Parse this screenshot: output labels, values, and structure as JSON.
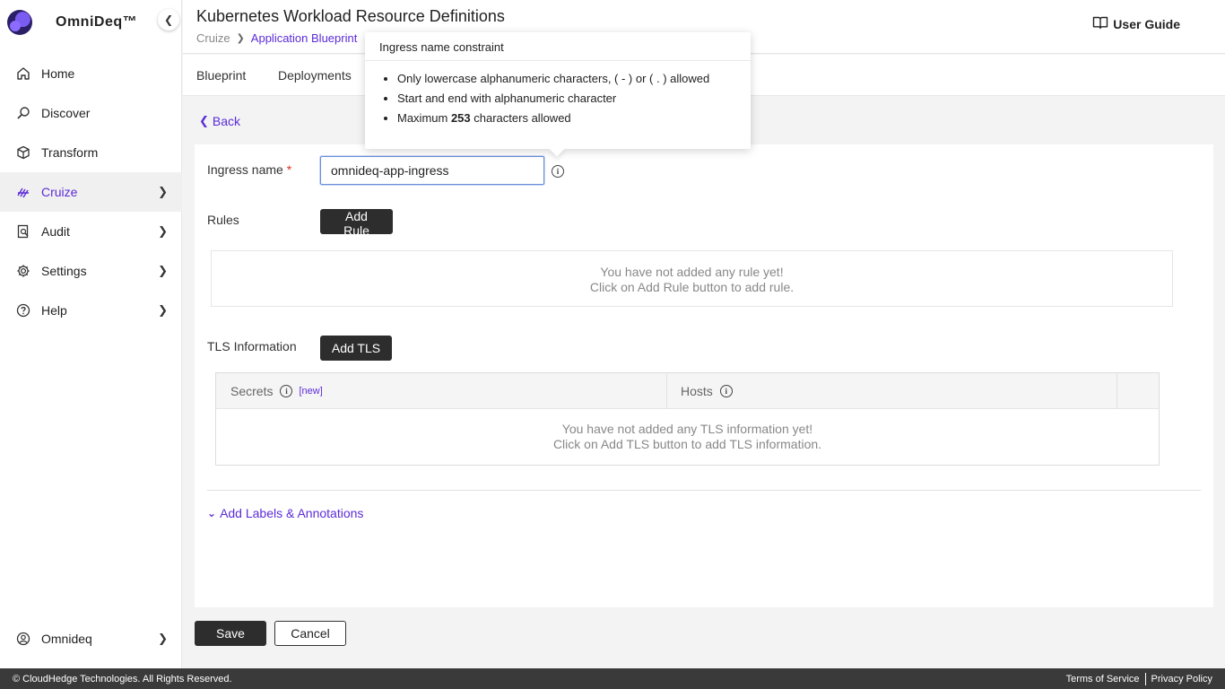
{
  "brand": {
    "name": "OmniDeq™"
  },
  "sidebar": {
    "items": [
      {
        "label": "Home",
        "icon": "home-icon",
        "chevron": false
      },
      {
        "label": "Discover",
        "icon": "discover-icon",
        "chevron": false
      },
      {
        "label": "Transform",
        "icon": "cube-icon",
        "chevron": false
      },
      {
        "label": "Cruize",
        "icon": "cruize-icon",
        "chevron": true,
        "active": true
      },
      {
        "label": "Audit",
        "icon": "audit-icon",
        "chevron": true
      },
      {
        "label": "Settings",
        "icon": "gear-icon",
        "chevron": true
      },
      {
        "label": "Help",
        "icon": "help-icon",
        "chevron": true
      }
    ],
    "footer": {
      "label": "Omnideq",
      "icon": "user-icon"
    }
  },
  "header": {
    "title": "Kubernetes Workload Resource Definitions",
    "breadcrumb": [
      "Cruize",
      "Application Blueprint"
    ],
    "user_guide": "User Guide"
  },
  "tabs": [
    "Blueprint",
    "Deployments"
  ],
  "back_label": "Back",
  "form": {
    "ingress_label": "Ingress name",
    "required_mark": "*",
    "ingress_value": "omnideq-app-ingress",
    "rules_label": "Rules",
    "add_rule": "Add Rule",
    "rules_empty_line1": "You have not added any rule yet!",
    "rules_empty_line2": "Click on Add Rule button to add rule.",
    "tls_label": "TLS Information",
    "add_tls": "Add TLS",
    "tls_columns": {
      "secrets": "Secrets",
      "new_link": "[new]",
      "hosts": "Hosts"
    },
    "tls_empty_line1": "You have not added any TLS information yet!",
    "tls_empty_line2": "Click on Add TLS button to add TLS information.",
    "add_labels": "Add Labels & Annotations"
  },
  "actions": {
    "save": "Save",
    "cancel": "Cancel"
  },
  "tooltip": {
    "title": "Ingress name constraint",
    "items": [
      "Only lowercase alphanumeric characters, ( - ) or ( . ) allowed",
      "Start and end with alphanumeric character"
    ],
    "max_prefix": "Maximum ",
    "max_value": "253",
    "max_suffix": " characters allowed"
  },
  "footer": {
    "copyright": "© CloudHedge Technologies. All Rights Reserved.",
    "terms": "Terms of Service",
    "privacy": "Privacy Policy"
  },
  "colors": {
    "accent": "#5b2bd8",
    "dark_button": "#2d2d2d",
    "footer_bg": "#3a3a3a"
  }
}
